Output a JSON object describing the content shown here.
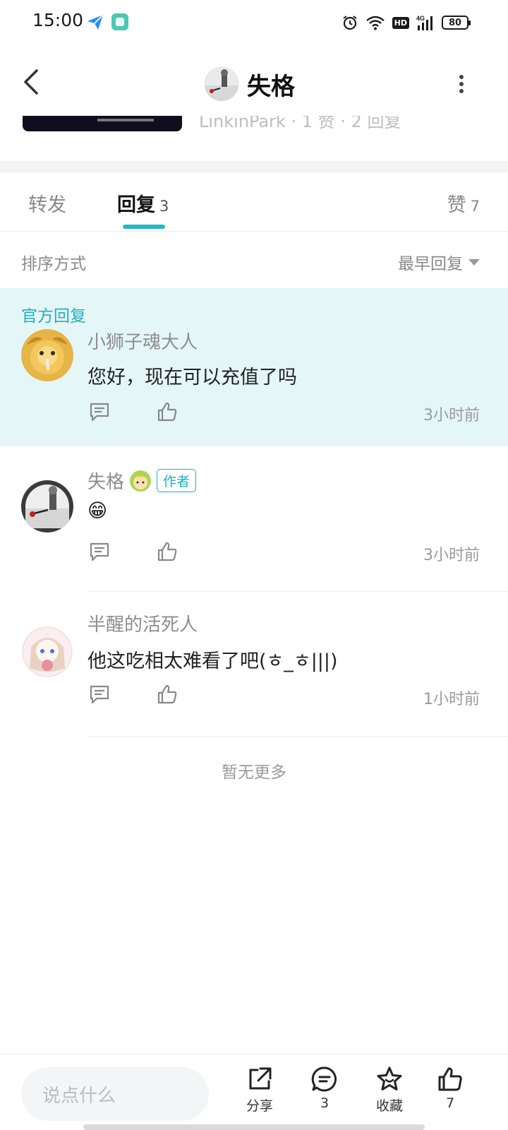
{
  "status_bar": {
    "time": "15:00",
    "battery": "80",
    "hd": "HD",
    "network": "4G"
  },
  "header": {
    "title": "失格",
    "icons": [
      "back-icon",
      "more-icon"
    ]
  },
  "post_preview": {
    "meta": "LinkinPark · 1 赞 · 2 回复"
  },
  "tabs": [
    {
      "label": "转发",
      "count": ""
    },
    {
      "label": "回复",
      "count": "3"
    },
    {
      "label": "赞",
      "count": "7"
    }
  ],
  "sort": {
    "label": "排序方式",
    "selected": "最早回复"
  },
  "official_label": "官方回复",
  "comments": [
    {
      "user": "小狮子魂大人",
      "text": "您好，现在可以充值了吗",
      "time": "3小时前",
      "badge": ""
    },
    {
      "user": "失格",
      "text": "😁",
      "time": "3小时前",
      "badge": "作者"
    },
    {
      "user": "半醒的活死人",
      "text": "他这吃相太难看了吧(ㅎ_ㅎ|||)",
      "time": "1小时前",
      "badge": ""
    }
  ],
  "no_more": "暂无更多",
  "bottom_bar": {
    "input_placeholder": "说点什么",
    "share_label": "分享",
    "comment_count": "3",
    "favorite_label": "收藏",
    "like_count": "7"
  },
  "colors": {
    "accent": "#20b8c4",
    "official_bg": "#e5f6f8"
  }
}
